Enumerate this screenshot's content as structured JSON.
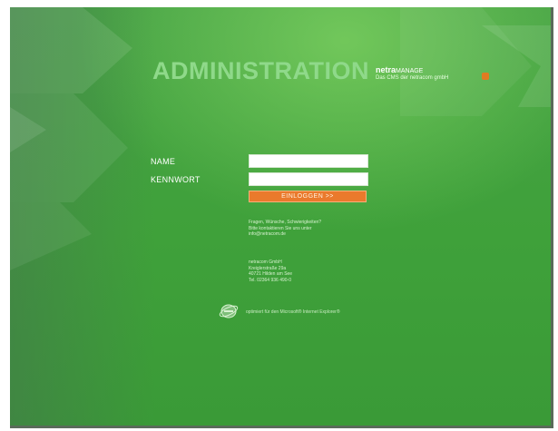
{
  "header": {
    "title": "ADMINISTRATION",
    "brand_name": "netra",
    "brand_suffix": "MANAGE",
    "brand_tagline": "Das CMS der netracom gmbH"
  },
  "login": {
    "name_label": "NAME",
    "password_label": "KENNWORT",
    "name_value": "",
    "password_value": "",
    "submit_label": "EINLOGGEN >>"
  },
  "info": {
    "questions": [
      "Fragen, Wünsche, Schwierigkeiten?",
      "Bitte kontaktieren Sie uns unter",
      "info@netracom.de"
    ],
    "address": [
      "netracom GmbH",
      "Kreiglerstraße 29a",
      "40721 Hilden am See",
      "Tel. 02364 936 490-0"
    ]
  },
  "footer": {
    "ie_note": "optimiert für den Microsoft® Internet Explorer®",
    "ie_icon": "internet-explorer-icon"
  },
  "colors": {
    "background": "#3fa13a",
    "button": "#ea7a2c",
    "title": "#8fd98a"
  }
}
